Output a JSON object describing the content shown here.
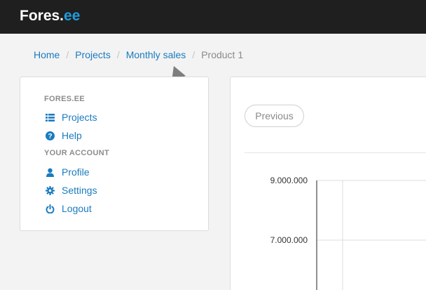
{
  "header": {
    "brand_main": "Fores.",
    "brand_accent": "ee"
  },
  "breadcrumb": {
    "items": [
      "Home",
      "Projects",
      "Monthly sales"
    ],
    "current": "Product 1",
    "separator": "/"
  },
  "sidebar": {
    "section1_title": "FORES.EE",
    "section1_items": [
      {
        "label": "Projects",
        "icon": "list-icon"
      },
      {
        "label": "Help",
        "icon": "question-icon"
      }
    ],
    "section2_title": "YOUR ACCOUNT",
    "section2_items": [
      {
        "label": "Profile",
        "icon": "user-icon"
      },
      {
        "label": "Settings",
        "icon": "gear-icon"
      },
      {
        "label": "Logout",
        "icon": "power-icon"
      }
    ]
  },
  "main": {
    "previous_label": "Previous",
    "chart_ticks": [
      "9.000.000",
      "7.000.000"
    ]
  },
  "colors": {
    "accent": "#1e9ce0",
    "link": "#1a7bbf",
    "topbar": "#1f1f1f"
  }
}
